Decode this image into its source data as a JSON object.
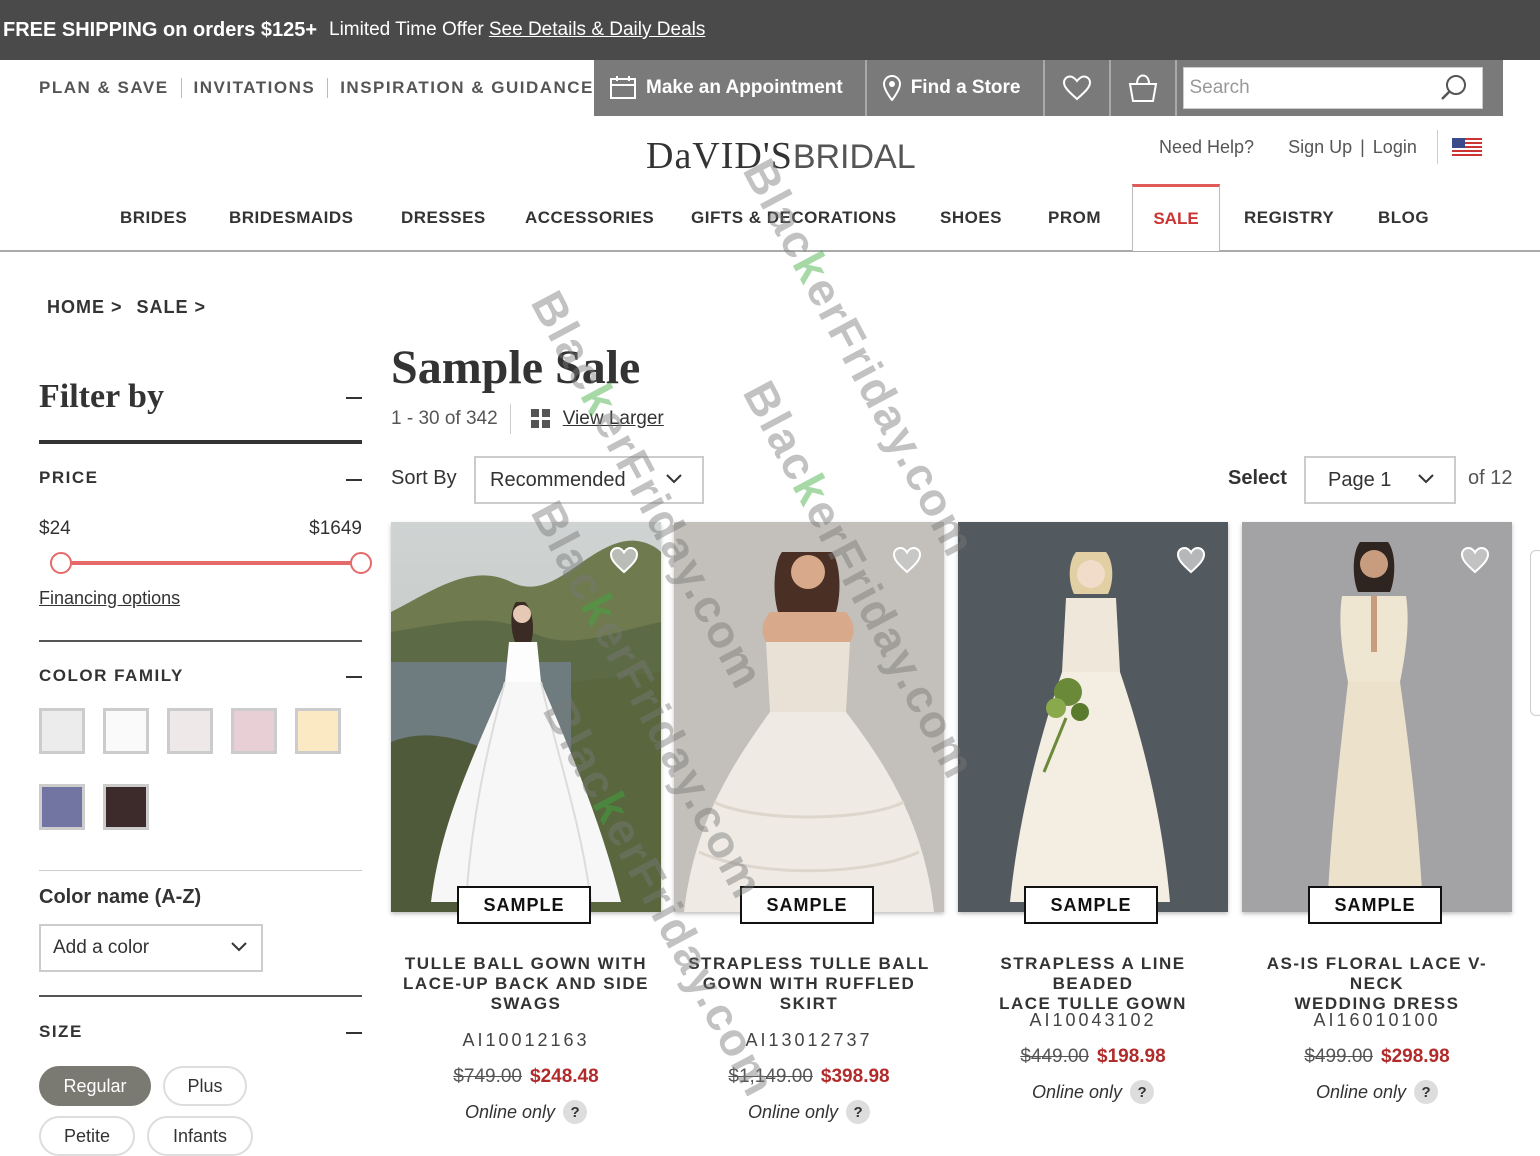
{
  "promo": {
    "headline": "FREE SHIPPING on orders $125+",
    "offer": "Limited Time Offer",
    "link": "See Details & Daily Deals"
  },
  "utility_nav": {
    "links": [
      "PLAN & SAVE",
      "INVITATIONS",
      "INSPIRATION & GUIDANCE"
    ],
    "appointment": "Make an Appointment",
    "find_store": "Find a Store",
    "search_placeholder": "Search"
  },
  "brand": {
    "logo_bold": "DaVID'S",
    "logo_light": "BRIDAL"
  },
  "account": {
    "help": "Need Help?",
    "sign_up": "Sign Up",
    "separator": "|",
    "login": "Login"
  },
  "main_nav": [
    "BRIDES",
    "BRIDESMAIDS",
    "DRESSES",
    "ACCESSORIES",
    "GIFTS & DECORATIONS",
    "SHOES",
    "PROM",
    "SALE",
    "REGISTRY",
    "BLOG"
  ],
  "breadcrumb": [
    "HOME >",
    "SALE >"
  ],
  "filters": {
    "title": "Filter by",
    "price": {
      "title": "PRICE",
      "min": "$24",
      "max": "$1649",
      "financing": "Financing options"
    },
    "color_family": {
      "title": "COLOR FAMILY",
      "swatches": [
        "#ececec",
        "#fafafa",
        "#eee8e8",
        "#e8cfd5",
        "#fbe9c4",
        "#7275a2",
        "#3d2b2b"
      ]
    },
    "color_name": {
      "title": "Color name (A-Z)",
      "placeholder": "Add a color"
    },
    "size": {
      "title": "SIZE",
      "options": [
        "Regular",
        "Plus",
        "Petite",
        "Infants"
      ],
      "selected": "Regular"
    }
  },
  "results": {
    "title": "Sample Sale",
    "count": "1 - 30 of 342",
    "view_larger": "View Larger",
    "sort_label": "Sort By",
    "sort_value": "Recommended",
    "select_label": "Select",
    "page_value": "Page 1",
    "page_total": "of 12"
  },
  "products": [
    {
      "badge": "SAMPLE",
      "name_lines": [
        "TULLE BALL GOWN WITH",
        "LACE-UP BACK AND SIDE",
        "SWAGS"
      ],
      "sku": "AI10012163",
      "old_price": "$749.00",
      "new_price": "$248.48",
      "note": "Online only",
      "help": "?"
    },
    {
      "badge": "SAMPLE",
      "name_lines": [
        "STRAPLESS TULLE BALL",
        "GOWN WITH RUFFLED",
        "SKIRT"
      ],
      "sku": "AI13012737",
      "old_price": "$1,149.00",
      "new_price": "$398.98",
      "note": "Online only",
      "help": "?"
    },
    {
      "badge": "SAMPLE",
      "name_lines": [
        "STRAPLESS A LINE BEADED",
        "LACE TULLE GOWN"
      ],
      "sku": "AI10043102",
      "old_price": "$449.00",
      "new_price": "$198.98",
      "note": "Online only",
      "help": "?"
    },
    {
      "badge": "SAMPLE",
      "name_lines": [
        "AS-IS FLORAL LACE V-NECK",
        "WEDDING DRESS"
      ],
      "sku": "AI16010100",
      "old_price": "$499.00",
      "new_price": "$298.98",
      "note": "Online only",
      "help": "?"
    }
  ],
  "watermark": {
    "part1": "Blac",
    "part2": "k",
    "part3": "er",
    "part4": "Friday.com"
  },
  "colors": {
    "accent_red": "#b22b2b",
    "slider": "#e66a6a",
    "promo_bg": "#4a4a4a"
  }
}
